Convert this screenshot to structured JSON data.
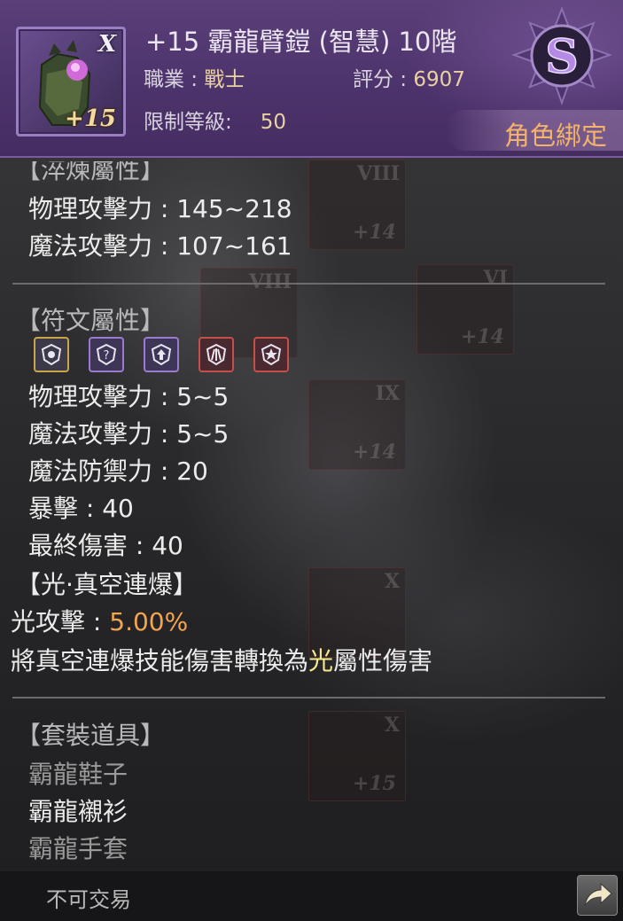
{
  "item": {
    "title": "+15 霸龍臂鎧 (智慧) 10階",
    "rank_roman": "X",
    "enhance_label": "+15",
    "grade_letter": "S",
    "job_label": "職業 : ",
    "job_value": "戰士",
    "score_label": "評分 : ",
    "score_value": "6907",
    "level_label": "限制等級:",
    "level_value": "50",
    "bound_label": "角色綁定"
  },
  "random_attr": {
    "header": "【淬煉屬性】",
    "stats": [
      "物理攻擊力 : 145~218",
      "魔法攻擊力 : 107~161"
    ]
  },
  "rune_attr": {
    "header": "【符文屬性】",
    "runes": [
      {
        "icon": "shield-rune-icon",
        "color": "#c9a64a"
      },
      {
        "icon": "question-rune-icon",
        "color": "#9b7bd0"
      },
      {
        "icon": "up-arrow-rune-icon",
        "color": "#9b7bd0"
      },
      {
        "icon": "claw-rune-icon",
        "color": "#c4504a"
      },
      {
        "icon": "burst-rune-icon",
        "color": "#c4504a"
      }
    ],
    "stats": [
      "物理攻擊力 : 5~5",
      "魔法攻擊力 : 5~5",
      "魔法防禦力 : 20",
      "暴擊 : 40",
      "最終傷害 : 40"
    ]
  },
  "special": {
    "header": "【光·真空連爆】",
    "attack_label": "光攻擊 : ",
    "attack_value": "5.00%",
    "desc_pre": "將真空連爆技能傷害轉換為",
    "desc_highlight": "光",
    "desc_post": "屬性傷害"
  },
  "set_items": {
    "header": "【套裝道具】",
    "items": [
      "霸龍鞋子",
      "霸龍襯衫",
      "霸龍手套"
    ]
  },
  "footer": {
    "trade_status": "不可交易"
  },
  "colors": {
    "header_purple": "#4d336b",
    "bound_orange": "#f3b36a",
    "value_orange": "#f1a452",
    "highlight_yellow": "#f6e98b"
  }
}
